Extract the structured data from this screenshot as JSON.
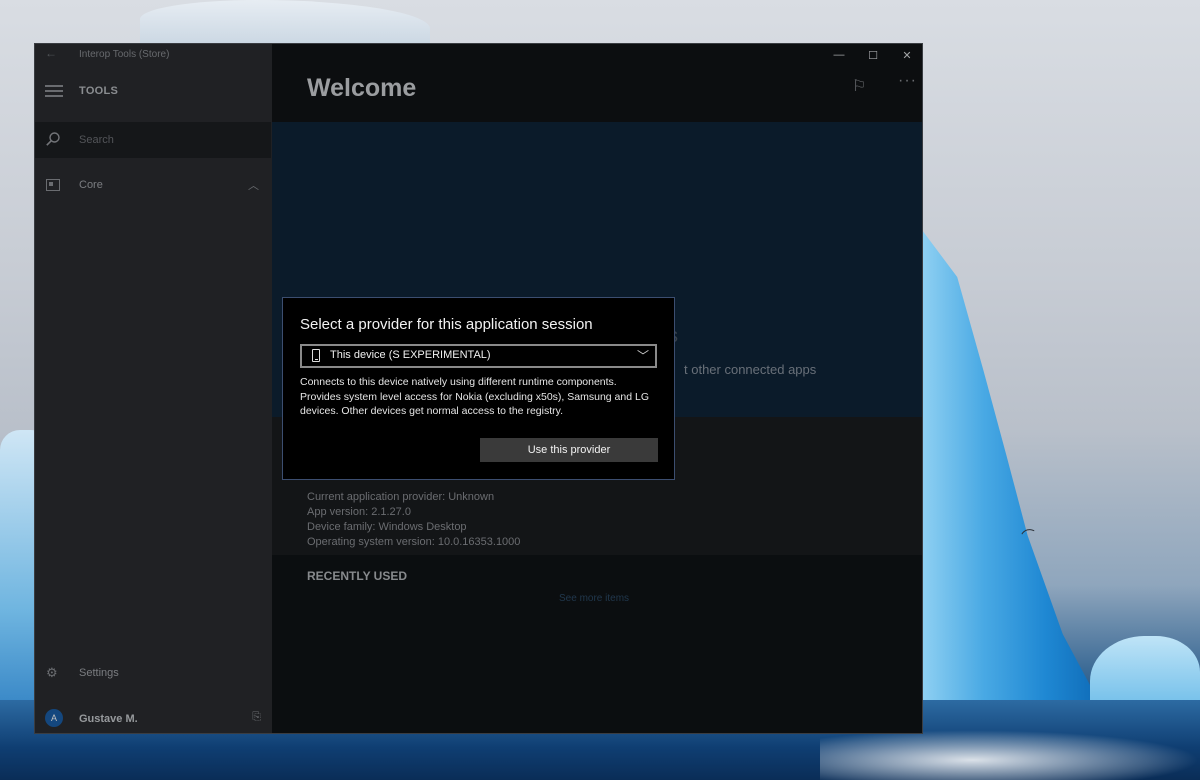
{
  "window": {
    "title": "Interop Tools (Store)",
    "caption_minimize": "—",
    "caption_maximize": "☐",
    "caption_close": "✕"
  },
  "sidebar": {
    "header_label": "TOOLS",
    "search_placeholder": "Search",
    "items": [
      {
        "label": "Core",
        "icon": "dashboard-icon",
        "expanded": true
      },
      {
        "label": "Settings",
        "icon": "gear-icon"
      }
    ],
    "user": {
      "name": "Gustave M.",
      "avatar_initial": "A"
    }
  },
  "main": {
    "page_title": "Welcome",
    "hero_partial_text": "t other connected apps",
    "hero_partial_char": "s",
    "info": {
      "provider_line": "Current application provider: Unknown",
      "app_version_line": "App version: 2.1.27.0",
      "device_family_line": "Device family: Windows Desktop",
      "os_version_line": "Operating system version: 10.0.16353.1000"
    },
    "recently_used_title": "RECENTLY USED",
    "see_more_link": "See more items"
  },
  "dialog": {
    "title": "Select a provider for this application session",
    "selected_provider": "This device (S EXPERIMENTAL)",
    "description": "Connects to this device natively using different runtime components. Provides system level access for Nokia (excluding x50s), Samsung and LG devices. Other devices get normal access to the registry.",
    "confirm_button": "Use this provider"
  },
  "colors": {
    "accent": "#1b5fa8",
    "dialog_border": "#3c4e70",
    "sidebar_bg": "#2b2d31",
    "hero_bg": "#0f2438"
  }
}
